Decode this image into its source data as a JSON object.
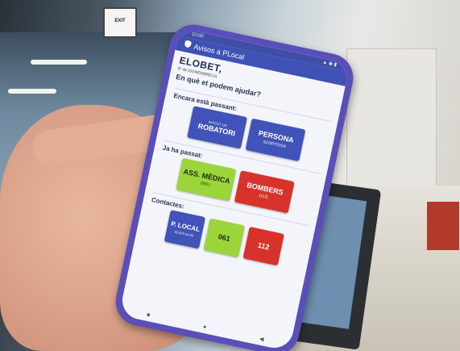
{
  "scene": {
    "exit_sign_text": "EXIT"
  },
  "phone": {
    "status": {
      "time": "10:00",
      "icons": "▲ ◉ ▮"
    },
    "appbar": {
      "icon": "shield-icon",
      "title": "Avisos a PLocal"
    },
    "greeting": {
      "name": "ELOBET,",
      "subtitle": "IF de ISONEMBRECA",
      "question": "En què et podem ajudar?"
    },
    "sections": [
      {
        "heading": "Encara està passant:",
        "tiles": [
          {
            "top": "INTENT DE",
            "main": "ROBATORI",
            "sub": ""
          },
          {
            "top": "",
            "main": "PERSONA",
            "sub": "SOSPITOSA"
          }
        ]
      },
      {
        "heading": "Ja ha passat:",
        "tiles": [
          {
            "top": "",
            "main": "ASS. MÈDICA",
            "sub": "(061)"
          },
          {
            "top": "",
            "main": "BOMBERS",
            "sub": "(112)"
          }
        ]
      },
      {
        "heading": "Contactes:",
        "tiles": [
          {
            "top": "",
            "main": "P. LOCAL",
            "sub": "93 870 24 99"
          },
          {
            "top": "",
            "main": "061",
            "sub": ""
          },
          {
            "top": "",
            "main": "112",
            "sub": ""
          }
        ]
      }
    ],
    "nav": {
      "back": "◀",
      "home": "●",
      "recent": "■"
    }
  },
  "colors": {
    "appbar": "#3f51b5",
    "tile_blue": "#4153b8",
    "tile_green": "#9bd53a",
    "tile_red": "#d7322b"
  }
}
